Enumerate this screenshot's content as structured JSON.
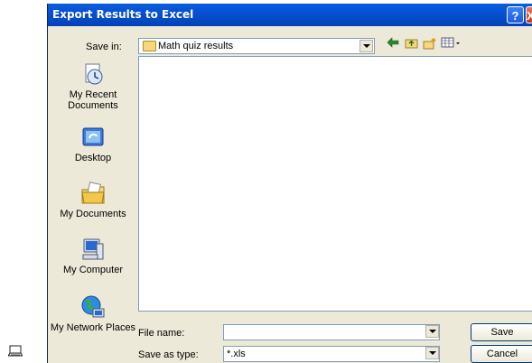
{
  "window": {
    "title": "Export Results to Excel",
    "help_glyph": "?",
    "close_glyph": "X"
  },
  "save_in": {
    "label": "Save in:",
    "value": "Math quiz results"
  },
  "places": [
    {
      "label": "My Recent Documents"
    },
    {
      "label": "Desktop"
    },
    {
      "label": "My Documents"
    },
    {
      "label": "My Computer"
    },
    {
      "label": "My Network Places"
    }
  ],
  "file_name": {
    "label": "File name:",
    "value": ""
  },
  "save_as_type": {
    "label": "Save as type:",
    "value": "*.xls"
  },
  "buttons": {
    "save": "Save",
    "cancel": "Cancel"
  },
  "icons": {
    "back": "back-arrow-icon",
    "up": "up-folder-icon",
    "new_folder": "new-folder-icon",
    "views": "views-menu-icon",
    "taskbar": "laptop-icon"
  },
  "colors": {
    "titlebar": "#0550d0",
    "dialog_bg": "#ece9d8",
    "border": "#7f9db9"
  }
}
